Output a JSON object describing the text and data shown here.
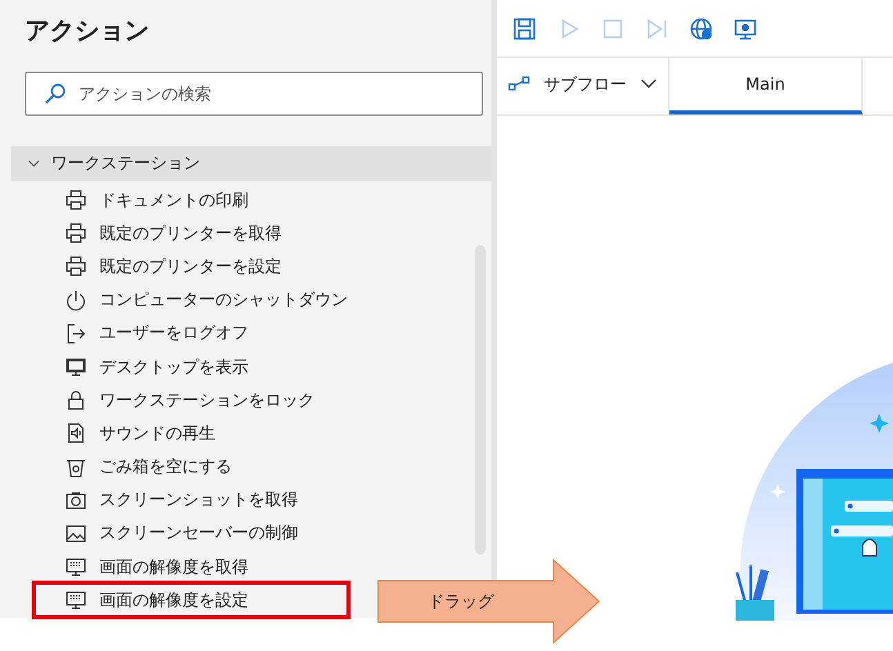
{
  "actions_panel": {
    "title": "アクション",
    "search": {
      "placeholder": "アクションの検索"
    },
    "group": {
      "label": "ワークステーション",
      "expanded": true,
      "items": [
        {
          "label": "ドキュメントの印刷",
          "kind": "printer",
          "highlighted": false
        },
        {
          "label": "既定のプリンターを取得",
          "kind": "printer",
          "highlighted": false
        },
        {
          "label": "既定のプリンターを設定",
          "kind": "printer",
          "highlighted": false
        },
        {
          "label": "コンピューターのシャットダウン",
          "kind": "power",
          "highlighted": false
        },
        {
          "label": "ユーザーをログオフ",
          "kind": "logoff",
          "highlighted": false
        },
        {
          "label": "デスクトップを表示",
          "kind": "desktop",
          "highlighted": false
        },
        {
          "label": "ワークステーションをロック",
          "kind": "lock",
          "highlighted": false
        },
        {
          "label": "サウンドの再生",
          "kind": "sound",
          "highlighted": false
        },
        {
          "label": "ごみ箱を空にする",
          "kind": "bin",
          "highlighted": false
        },
        {
          "label": "スクリーンショットを取得",
          "kind": "camera",
          "highlighted": false
        },
        {
          "label": "スクリーンセーバーの制御",
          "kind": "image",
          "highlighted": false
        },
        {
          "label": "画面の解像度を取得",
          "kind": "display",
          "highlighted": false
        },
        {
          "label": "画面の解像度を設定",
          "kind": "display",
          "highlighted": true
        }
      ]
    }
  },
  "toolbar": [
    {
      "kind": "save",
      "disabled": false
    },
    {
      "kind": "run",
      "disabled": true
    },
    {
      "kind": "stop",
      "disabled": true
    },
    {
      "kind": "step",
      "disabled": true
    },
    {
      "kind": "web",
      "disabled": false
    },
    {
      "kind": "desktop",
      "disabled": false
    }
  ],
  "tabs": [
    {
      "label": "サブフロー",
      "kind": "subflow",
      "selected": false
    },
    {
      "label": "Main",
      "kind": "plain",
      "selected": true
    }
  ],
  "annotation": {
    "label": "ドラッグ"
  }
}
